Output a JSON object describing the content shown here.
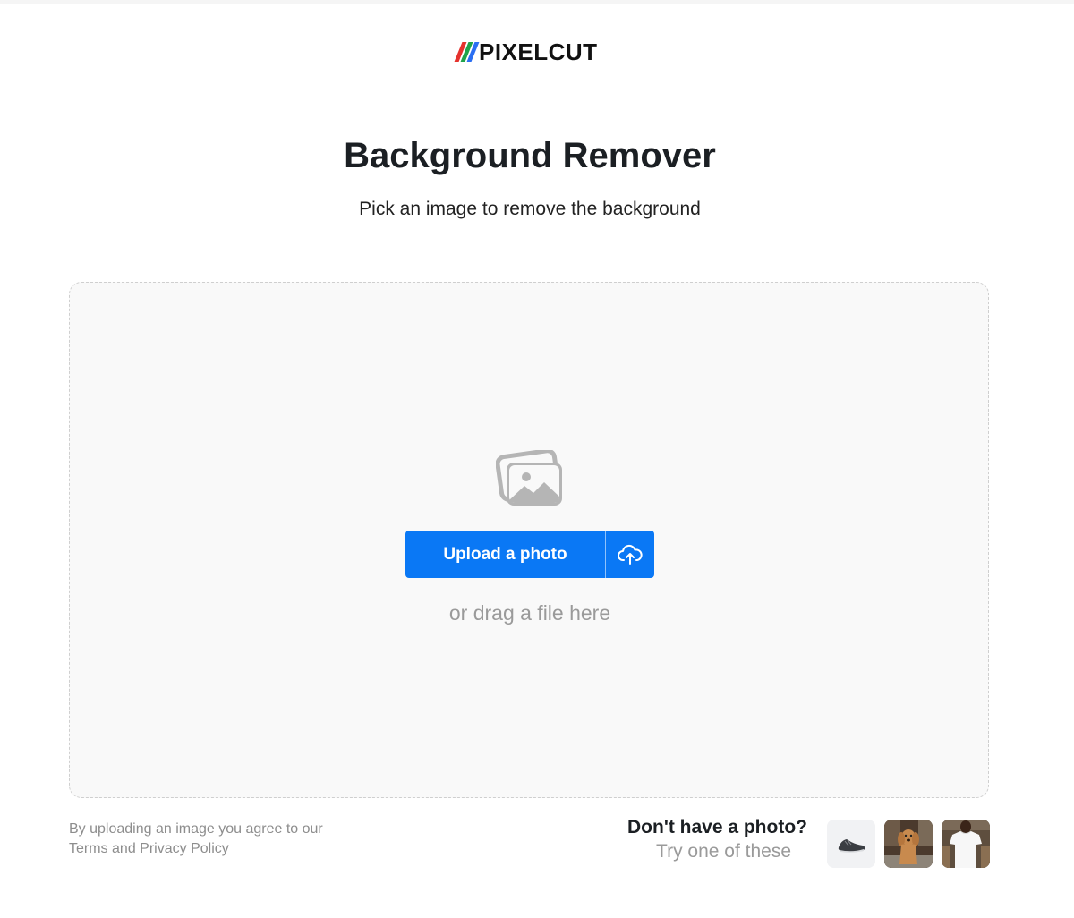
{
  "brand": {
    "name": "PIXELCUT",
    "stripe_colors": [
      "#e5322d",
      "#1fa34a",
      "#2a6ef2"
    ]
  },
  "hero": {
    "title": "Background Remover",
    "subtitle": "Pick an image to remove the background"
  },
  "dropzone": {
    "icon": "photos-icon",
    "upload_label": "Upload a photo",
    "upload_icon": "cloud-upload-icon",
    "drag_hint": "or drag a file here"
  },
  "legal": {
    "prefix": "By uploading an image you agree to our",
    "terms_label": "Terms",
    "and": "and",
    "privacy_label": "Privacy",
    "policy": "Policy"
  },
  "samples": {
    "heading": "Don't have a photo?",
    "subheading": "Try one of these",
    "items": [
      {
        "name": "sneaker-sample"
      },
      {
        "name": "dog-sample"
      },
      {
        "name": "tshirt-sample"
      }
    ]
  },
  "colors": {
    "accent": "#0a78f5",
    "muted_text": "#9a9a9a",
    "dropzone_bg": "#f9f9f9"
  }
}
